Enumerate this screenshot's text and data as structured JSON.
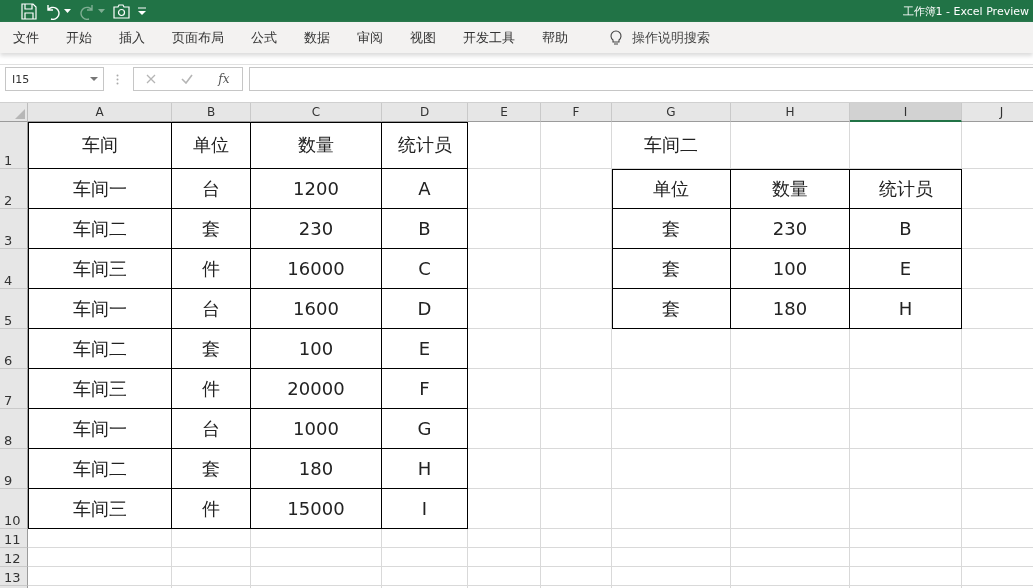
{
  "window": {
    "title": "工作簿1  -  Excel Preview"
  },
  "ribbon_tabs": [
    {
      "label": "文件"
    },
    {
      "label": "开始"
    },
    {
      "label": "插入"
    },
    {
      "label": "页面布局"
    },
    {
      "label": "公式"
    },
    {
      "label": "数据"
    },
    {
      "label": "审阅"
    },
    {
      "label": "视图"
    },
    {
      "label": "开发工具"
    },
    {
      "label": "帮助"
    }
  ],
  "search": {
    "placeholder": "操作说明搜索"
  },
  "formula_bar": {
    "name_box": "I15",
    "function_button": "fx"
  },
  "columns": [
    {
      "label": "A",
      "selected": false
    },
    {
      "label": "B",
      "selected": false
    },
    {
      "label": "C",
      "selected": false
    },
    {
      "label": "D",
      "selected": false
    },
    {
      "label": "E",
      "selected": false
    },
    {
      "label": "F",
      "selected": false
    },
    {
      "label": "G",
      "selected": false
    },
    {
      "label": "H",
      "selected": false
    },
    {
      "label": "I",
      "selected": true
    },
    {
      "label": "J",
      "selected": false
    }
  ],
  "rows": [
    "1",
    "2",
    "3",
    "4",
    "5",
    "6",
    "7",
    "8",
    "9",
    "10",
    "11",
    "12",
    "13"
  ],
  "tables": [
    {
      "bordered": true,
      "rows": [
        [
          "车间",
          "单位",
          "数量",
          "统计员"
        ],
        [
          "车间一",
          "台",
          "1200",
          "A"
        ],
        [
          "车间二",
          "套",
          "230",
          "B"
        ],
        [
          "车间三",
          "件",
          "16000",
          "C"
        ],
        [
          "车间一",
          "台",
          "1600",
          "D"
        ],
        [
          "车间二",
          "套",
          "100",
          "E"
        ],
        [
          "车间三",
          "件",
          "20000",
          "F"
        ],
        [
          "车间一",
          "台",
          "1000",
          "G"
        ],
        [
          "车间二",
          "套",
          "180",
          "H"
        ],
        [
          "车间三",
          "件",
          "15000",
          "I"
        ]
      ]
    },
    {
      "bordered": false,
      "rows": [
        [
          "车间二"
        ]
      ]
    },
    {
      "bordered": true,
      "rows": [
        [
          "单位",
          "数量",
          "统计员"
        ],
        [
          "套",
          "230",
          "B"
        ],
        [
          "套",
          "100",
          "E"
        ],
        [
          "套",
          "180",
          "H"
        ]
      ]
    }
  ]
}
